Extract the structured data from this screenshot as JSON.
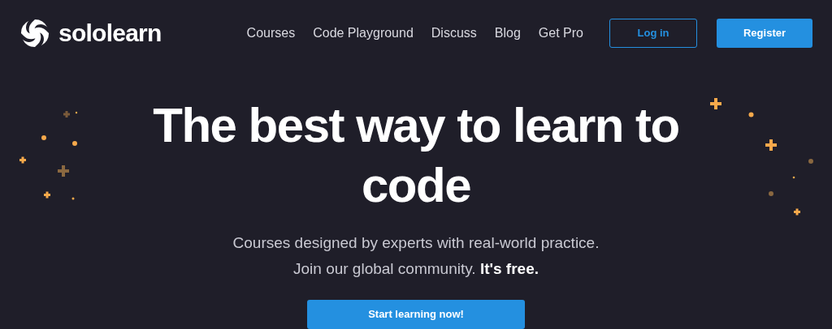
{
  "brand": {
    "name": "sololearn"
  },
  "nav": {
    "links": [
      {
        "label": "Courses"
      },
      {
        "label": "Code Playground"
      },
      {
        "label": "Discuss"
      },
      {
        "label": "Blog"
      },
      {
        "label": "Get Pro"
      }
    ],
    "buttons": [
      {
        "label": "Log in",
        "kind": "outline"
      },
      {
        "label": "Register",
        "kind": "filled"
      }
    ]
  },
  "hero": {
    "title": "The best way to learn to code",
    "subtitle": [
      "Courses designed by experts with real-world practice.",
      "Join our global community. **It's free.**"
    ],
    "cta": "Start learning now!"
  }
}
